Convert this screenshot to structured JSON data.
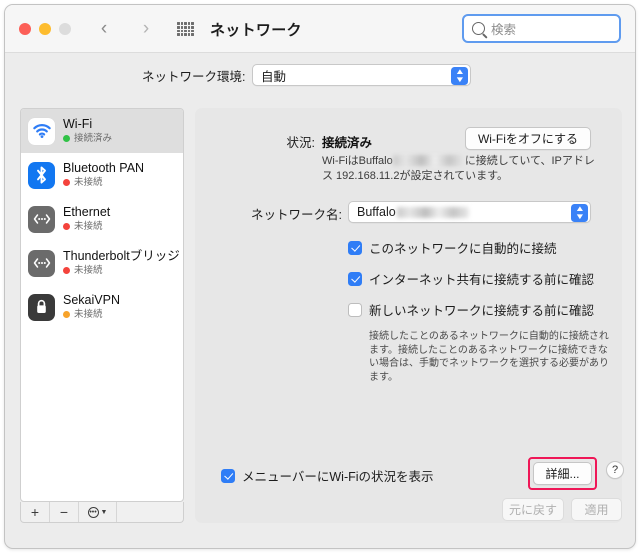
{
  "window": {
    "title": "ネットワーク",
    "traffic_lights": [
      "close",
      "minimize",
      "zoom"
    ],
    "nav_back": "‹",
    "nav_forward": "›",
    "grid_icon": "show-all-grid-icon"
  },
  "search": {
    "placeholder": "検索",
    "value": "",
    "icon": "search-icon",
    "focus_color": "#5f9bef"
  },
  "location": {
    "label": "ネットワーク環境:",
    "value": "自動",
    "options": [
      "自動"
    ]
  },
  "sidebar": {
    "services": [
      {
        "name": "Wi-Fi",
        "status": "接続済み",
        "status_color": "#30c246",
        "icon": "wifi-icon",
        "selected": true
      },
      {
        "name": "Bluetooth PAN",
        "status": "未接続",
        "status_color": "#f4433c",
        "icon": "bluetooth-icon",
        "selected": false
      },
      {
        "name": "Ethernet",
        "status": "未接続",
        "status_color": "#f4433c",
        "icon": "ethernet-icon",
        "selected": false
      },
      {
        "name": "Thunderboltブリッジ",
        "status": "未接続",
        "status_color": "#f4433c",
        "icon": "ethernet-icon",
        "selected": false
      },
      {
        "name": "SekaiVPN",
        "status": "未接続",
        "status_color": "#f7a32b",
        "icon": "vpn-lock-icon",
        "selected": false
      }
    ],
    "tools": {
      "add": "+",
      "remove": "−",
      "action": "gear-icon",
      "chevron": "chevron-down-icon"
    }
  },
  "main": {
    "status_label": "状況:",
    "status_value": "接続済み",
    "toggle_button": "Wi-Fiをオフにする",
    "status_desc_1": "Wi-FiはBuffalo",
    "status_desc_2": "に接続していて、IPアドレ",
    "status_desc_3": "ス 192.168.11.2が設定されています。",
    "network_name_label": "ネットワーク名:",
    "network_name_value": "Buffalo",
    "checkboxes": [
      {
        "label": "このネットワークに自動的に接続",
        "checked": true
      },
      {
        "label": "インターネット共有に接続する前に確認",
        "checked": true
      },
      {
        "label": "新しいネットワークに接続する前に確認",
        "checked": false
      }
    ],
    "hint_1": "接続したことのあるネットワークに自動的に接続され",
    "hint_2": "ます。接続したことのあるネットワークに接続できな",
    "hint_3": "い場合は、手動でネットワークを選択する必要があり",
    "hint_4": "ます。",
    "menubar_checkbox": {
      "label": "メニューバーにWi-Fiの状況を表示",
      "checked": true
    },
    "advanced_button": "詳細...",
    "help_button": "?",
    "highlight_color": "#ef1757"
  },
  "footer": {
    "revert_button": "元に戻す",
    "apply_button": "適用"
  }
}
